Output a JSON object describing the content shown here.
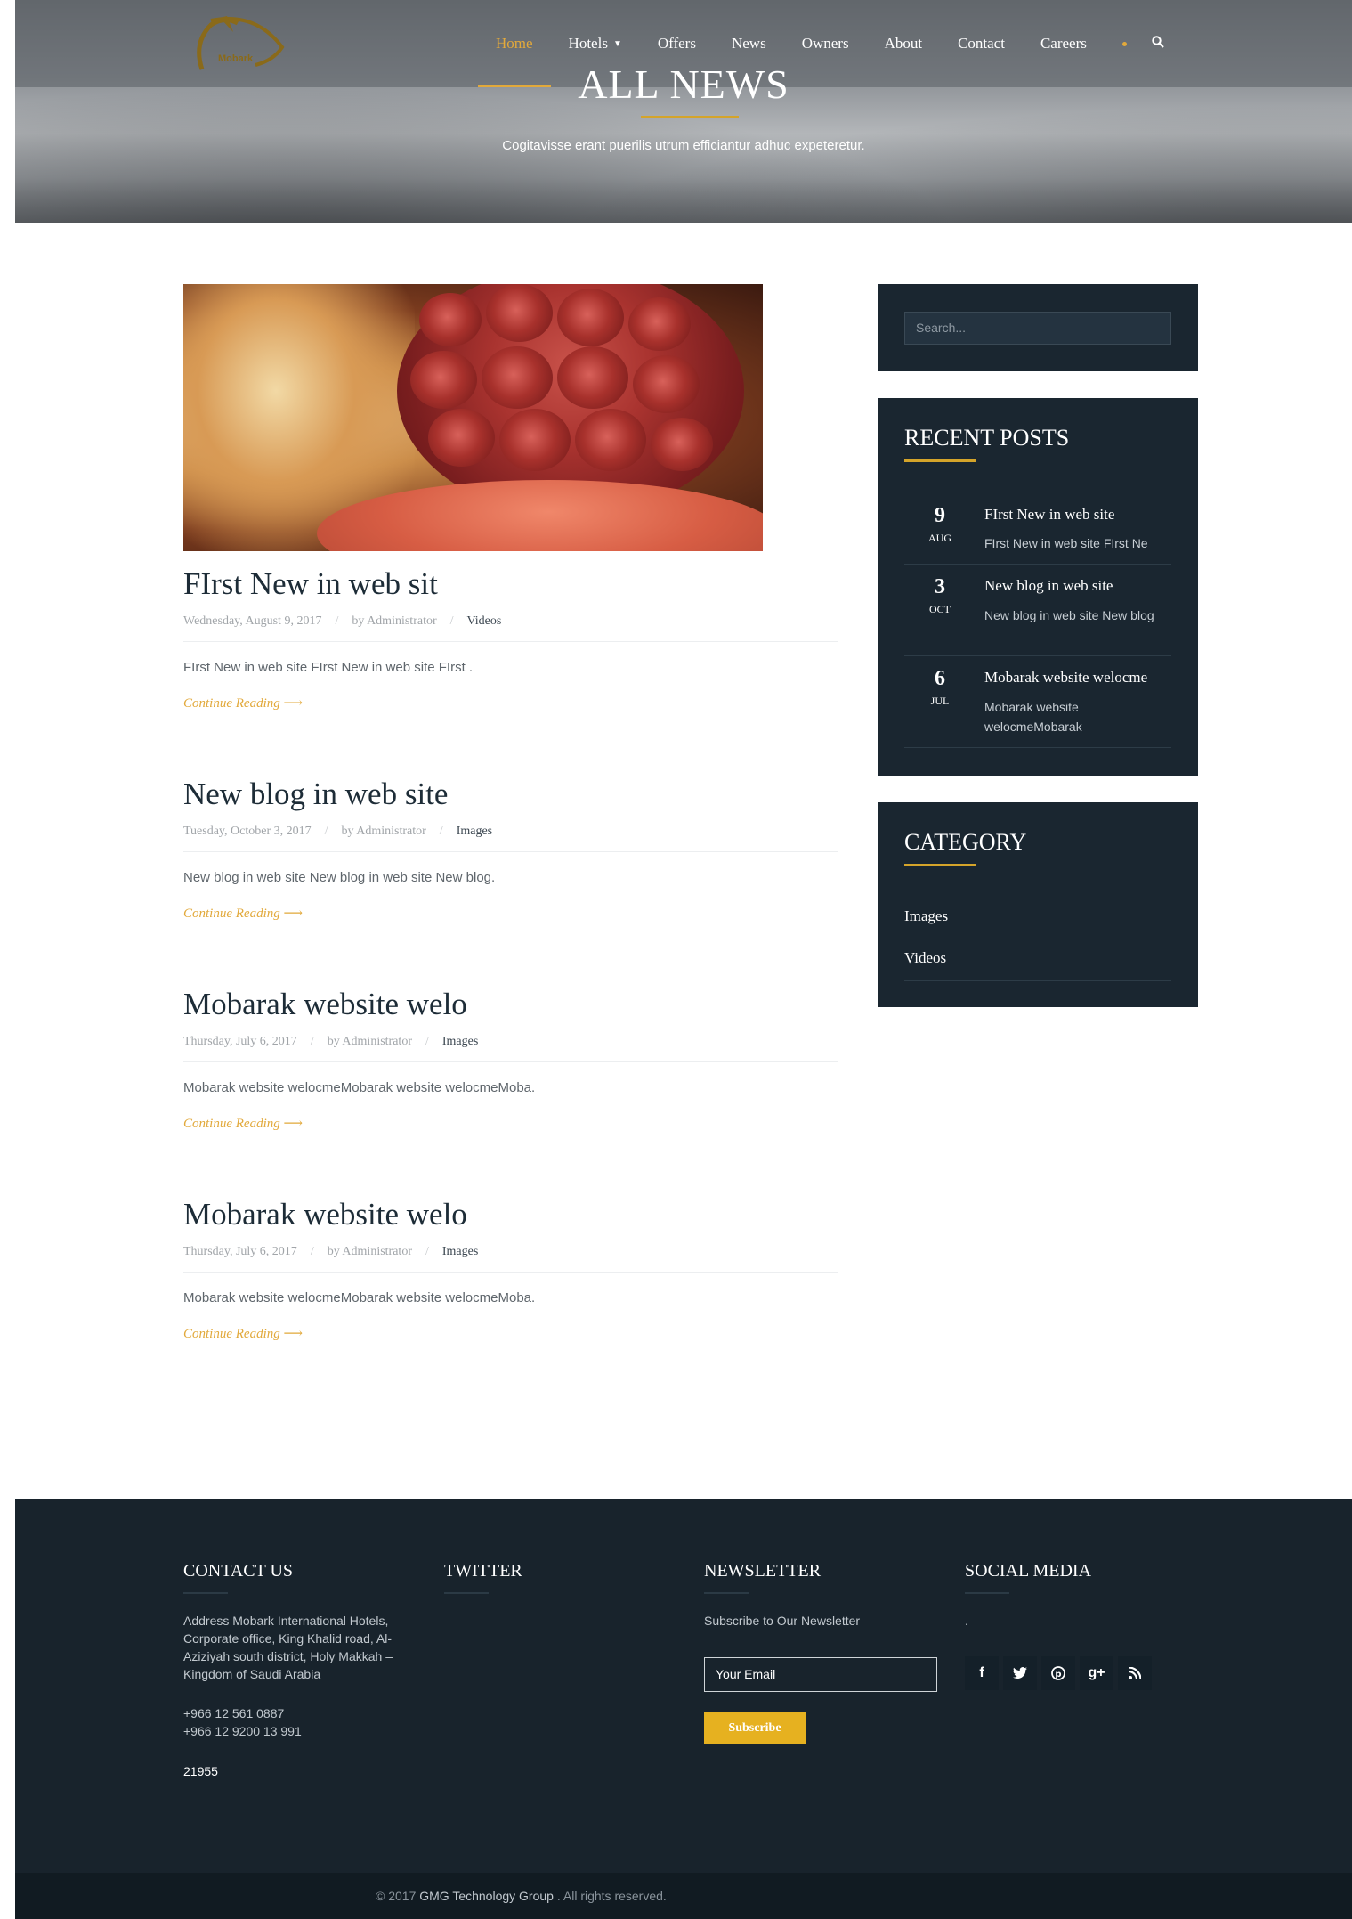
{
  "nav": {
    "logo_text": "Mobark",
    "items": [
      {
        "label": "Home",
        "active": true
      },
      {
        "label": "Hotels",
        "dropdown": true
      },
      {
        "label": "Offers"
      },
      {
        "label": "News"
      },
      {
        "label": "Owners"
      },
      {
        "label": "About"
      },
      {
        "label": "Contact"
      },
      {
        "label": "Careers"
      }
    ],
    "search_icon": "search-icon"
  },
  "hero": {
    "title": "ALL NEWS",
    "subtitle": "Cogitavisse erant puerilis utrum efficiantur adhuc expeteretur."
  },
  "posts": [
    {
      "title": "FIrst New in web sit",
      "date": "Wednesday, August 9, 2017",
      "author": "by Administrator",
      "category": "Videos",
      "excerpt": "FIrst New in web site FIrst New in web site FIrst .",
      "read_more": "Continue Reading ⟶"
    },
    {
      "title": "New blog in web site",
      "date": "Tuesday, October 3, 2017",
      "author": "by Administrator",
      "category": "Images",
      "excerpt": "New blog in web site New blog in web site New blog.",
      "read_more": "Continue Reading ⟶"
    },
    {
      "title": "Mobarak website welo",
      "date": "Thursday, July 6, 2017",
      "author": "by Administrator",
      "category": "Images",
      "excerpt": "Mobarak website welocmeMobarak website welocmeMoba.",
      "read_more": "Continue Reading ⟶"
    },
    {
      "title": "Mobarak website welo",
      "date": "Thursday, July 6, 2017",
      "author": "by Administrator",
      "category": "Images",
      "excerpt": "Mobarak website welocmeMobarak website welocmeMoba.",
      "read_more": "Continue Reading ⟶"
    }
  ],
  "sidebar": {
    "search_placeholder": "Search...",
    "recent_title": "RECENT POSTS",
    "recent": [
      {
        "day": "9",
        "month": "AUG",
        "title": "FIrst New in web site",
        "excerpt": "FIrst New in web site FIrst Ne"
      },
      {
        "day": "3",
        "month": "OCT",
        "title": "New blog in web site",
        "excerpt": "New blog in web site New blog"
      },
      {
        "day": "6",
        "month": "JUL",
        "title": "Mobarak website welocme",
        "excerpt": "Mobarak website welocmeMobarak"
      }
    ],
    "category_title": "CATEGORY",
    "categories": [
      "Images",
      "Videos"
    ]
  },
  "footer": {
    "contact": {
      "title": "CONTACT US",
      "address": "Address Mobark International Hotels, Corporate office, King Khalid road, Al-Aziziyah south district, Holy Makkah – Kingdom of Saudi Arabia",
      "phone1": "+966 12 561 0887",
      "phone2": "+966 12 9200 13 991",
      "pobox": "21955"
    },
    "twitter": {
      "title": "TWITTER"
    },
    "newsletter": {
      "title": "NEWSLETTER",
      "text": "Subscribe to Our Newsletter",
      "placeholder": "Your Email",
      "button": "Subscribe"
    },
    "social": {
      "title": "SOCIAL MEDIA",
      "text": ".",
      "icons": [
        "facebook-icon",
        "twitter-icon",
        "pinterest-icon",
        "google-plus-icon",
        "rss-icon"
      ]
    },
    "copyright": {
      "prefix": "© 2017",
      "brand": "GMG Technology Group",
      "suffix": ". All rights reserved."
    }
  },
  "colors": {
    "accent": "#e2a93b",
    "dark": "#1a2630",
    "footer": "#18232c"
  }
}
